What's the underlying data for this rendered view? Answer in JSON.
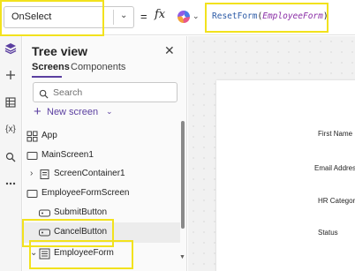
{
  "formula_bar": {
    "property": "OnSelect",
    "equals": "=",
    "fx": "fx",
    "formula_function": "ResetForm",
    "formula_open": "(",
    "formula_argument": "EmployeeForm",
    "formula_close": ")"
  },
  "left_rail": {
    "icons": [
      "layers-icon",
      "plus-icon",
      "table-icon",
      "variables-icon",
      "search-icon",
      "more-icon"
    ],
    "variables_glyph": "{x}"
  },
  "tree_view": {
    "title": "Tree view",
    "tabs": [
      "Screens",
      "Components"
    ],
    "search_placeholder": "Search",
    "new_screen_label": "New screen",
    "items": [
      {
        "label": "App",
        "icon": "app-icon"
      },
      {
        "label": "MainScreen1",
        "icon": "screen-icon"
      },
      {
        "label": "ScreenContainer1",
        "icon": "container-icon"
      },
      {
        "label": "EmployeeFormScreen",
        "icon": "screen-icon"
      },
      {
        "label": "SubmitButton",
        "icon": "button-icon"
      },
      {
        "label": "CancelButton",
        "icon": "button-icon"
      },
      {
        "label": "EmployeeForm",
        "icon": "form-icon"
      }
    ]
  },
  "form_preview": {
    "fields": [
      "First Name",
      "Email Address",
      "HR Category",
      "Status"
    ]
  },
  "colors": {
    "accent": "#5b3fa0",
    "highlight": "#f2e21d",
    "formula_function": "#2b5aa6",
    "formula_argument": "#8a2da6"
  }
}
